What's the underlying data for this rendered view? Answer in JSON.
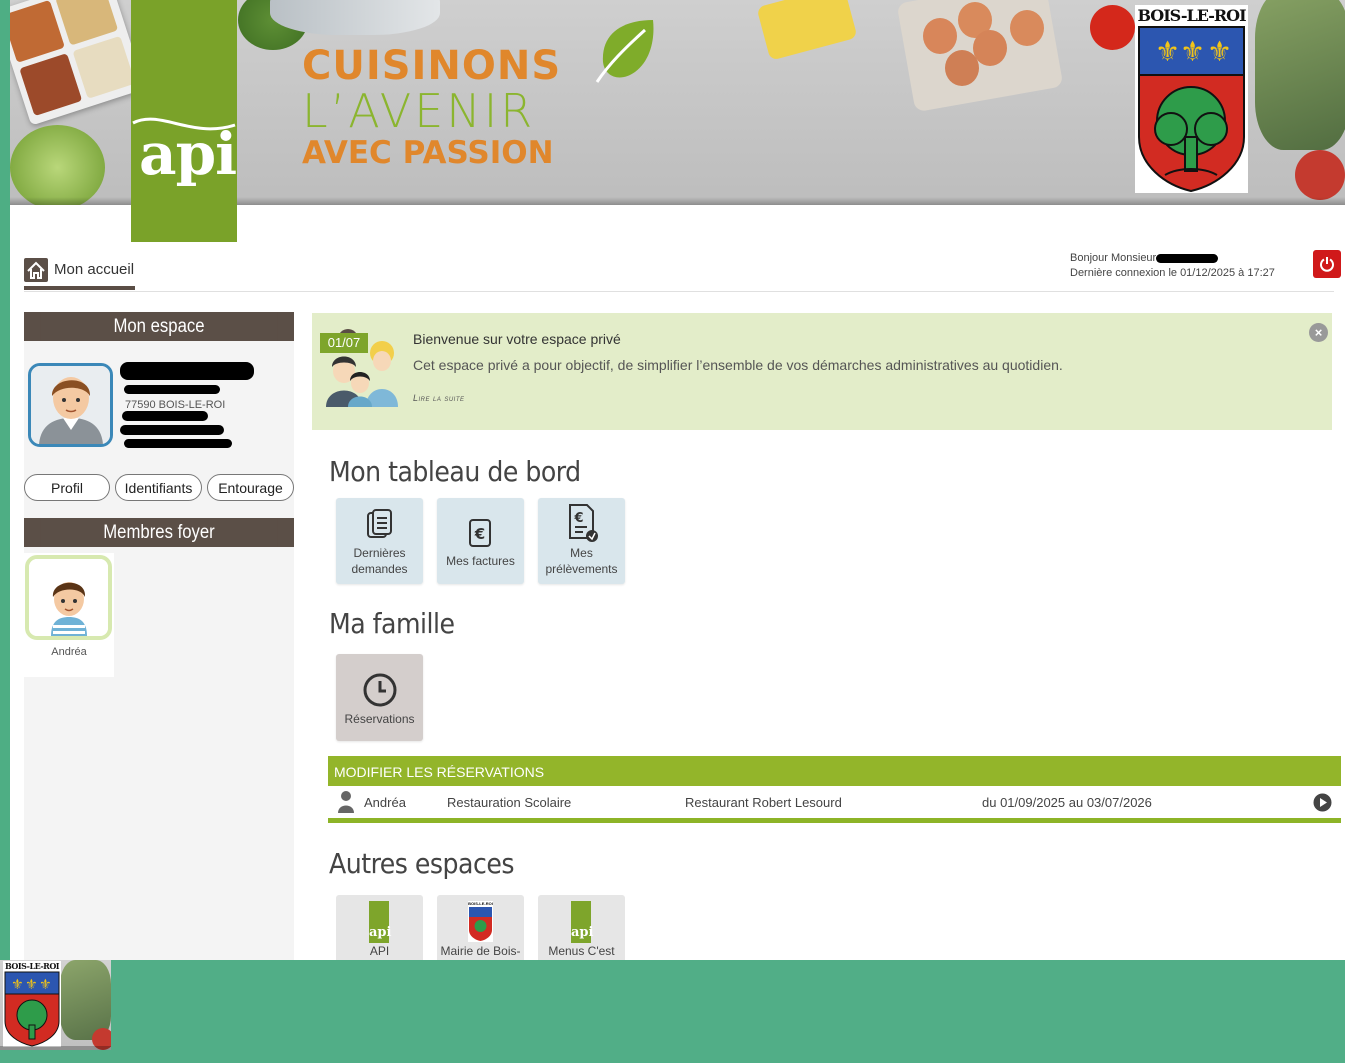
{
  "banner": {
    "logo_text": "api",
    "slogan_line1": "CUISINONS",
    "slogan_line2": "L’AVENIR",
    "slogan_line3": "AVEC PASSION",
    "town_name": "BOIS-LE-ROI"
  },
  "nav": {
    "home_label": "Mon accueil"
  },
  "user": {
    "greeting": "Bonjour Monsieur",
    "last_login": "Dernière connexion le 01/12/2025 à 17:27"
  },
  "sidebar": {
    "space_title": "Mon espace",
    "postcode_city": "77590 BOIS-LE-ROI",
    "buttons": [
      "Profil",
      "Identifiants",
      "Entourage"
    ],
    "members_title": "Membres foyer",
    "members": [
      {
        "name": "Andréa"
      }
    ]
  },
  "welcome": {
    "date": "01/07",
    "title": "Bienvenue sur votre espace privé",
    "body": "Cet espace privé a pour objectif, de simplifier l’ensemble de vos démarches administratives au quotidien.",
    "more": "Lire la suite"
  },
  "dashboard": {
    "title": "Mon tableau de bord",
    "tiles": [
      {
        "line1": "Dernières",
        "line2": "demandes",
        "icon": "documents-icon"
      },
      {
        "line1": "Mes factures",
        "line2": "",
        "icon": "invoice-euro-icon"
      },
      {
        "line1": "Mes",
        "line2": "prélèvements",
        "icon": "direct-debit-icon"
      }
    ]
  },
  "family": {
    "title": "Ma famille",
    "tile_label": "Réservations",
    "tile_icon": "clock-icon"
  },
  "reservations": {
    "header": "Modifier les réservations",
    "row": {
      "child": "Andréa",
      "service": "Restauration Scolaire",
      "place": "Restaurant Robert Lesourd",
      "period": "du 01/09/2025 au 03/07/2026"
    }
  },
  "other_spaces": {
    "title": "Autres espaces",
    "tiles": [
      {
        "label": "API",
        "logo_text": "api"
      },
      {
        "label": "Mairie de Bois-",
        "logo_text": "BOIS-LE-ROI"
      },
      {
        "label": "Menus C'est",
        "logo_text": "api"
      }
    ]
  },
  "colors": {
    "accent_green": "#93b52a",
    "header_brown": "#5b4f47",
    "logout_red": "#d0191a",
    "background_green": "#51ae87"
  }
}
